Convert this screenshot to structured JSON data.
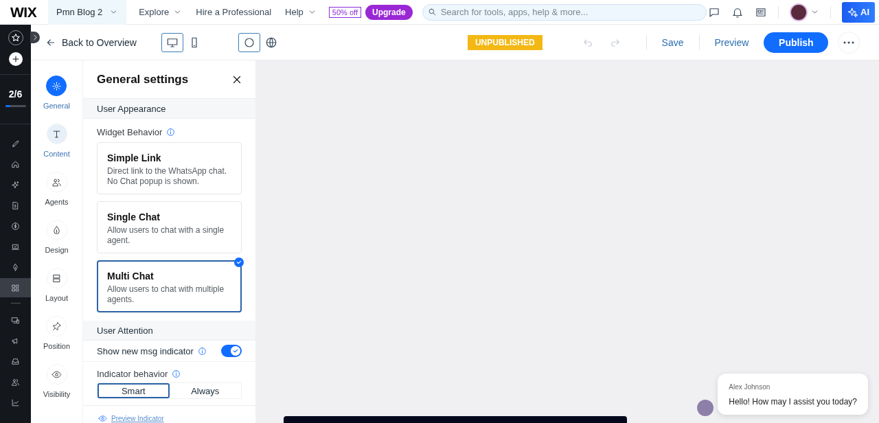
{
  "top_bar": {
    "logo": "WIX",
    "site": {
      "label": "Pmn Blog 2"
    },
    "menus": [
      {
        "label": "Explore",
        "dropdown": true
      },
      {
        "label": "Hire a Professional",
        "dropdown": false
      },
      {
        "label": "Help",
        "dropdown": true
      }
    ],
    "sale_badge": "50% off",
    "upgrade_button": "Upgrade",
    "search": {
      "placeholder": "Search for tools, apps, help & more..."
    },
    "ai_button": "AI"
  },
  "editor_bar": {
    "back_link": "Back to Overview",
    "devices": [
      {
        "selected": true
      },
      {
        "selected": false
      }
    ],
    "views": [
      {
        "selected": true
      },
      {
        "selected": false
      }
    ],
    "status": "UNPUBLISHED",
    "undo": {
      "disabled": true
    },
    "redo": {
      "disabled": true
    },
    "save": "Save",
    "preview": "Preview",
    "publish": "Publish"
  },
  "rail": {
    "progress": {
      "label": "2/6",
      "level": 0.25
    },
    "items": [
      {
        "selected": false
      },
      {
        "selected": false
      },
      {
        "selected": false
      },
      {
        "selected": false
      },
      {
        "selected": false
      },
      {
        "selected": false
      },
      {
        "selected": false
      },
      {
        "selected": true
      },
      {
        "selected": false
      },
      {
        "selected": false
      },
      {
        "selected": false
      },
      {
        "selected": false
      },
      {
        "selected": false
      }
    ]
  },
  "settings_nav": [
    {
      "label": "General",
      "selected": true,
      "hovered": false
    },
    {
      "label": "Content",
      "selected": false,
      "hovered": true
    },
    {
      "label": "Agents",
      "selected": false,
      "hovered": false
    },
    {
      "label": "Design",
      "selected": false,
      "hovered": false
    },
    {
      "label": "Layout",
      "selected": false,
      "hovered": false
    },
    {
      "label": "Position",
      "selected": false,
      "hovered": false
    },
    {
      "label": "Visibility",
      "selected": false,
      "hovered": false
    }
  ],
  "panel": {
    "title": "General settings",
    "appearance": {
      "heading": "User Appearance",
      "label": "Widget Behavior",
      "options": [
        {
          "title": "Simple Link",
          "description": "Direct link to the WhatsApp chat. No Chat popup is shown.",
          "selected": false
        },
        {
          "title": "Single Chat",
          "description": "Allow users to chat with a single agent.",
          "selected": false
        },
        {
          "title": "Multi Chat",
          "description": "Allow users to chat with multiple agents.",
          "selected": true
        }
      ]
    },
    "attention": {
      "heading": "User Attention",
      "toggle": {
        "label": "Show new msg indicator",
        "on": true
      },
      "indicator": {
        "label": "Indicator behavior",
        "choices": [
          {
            "label": "Smart",
            "selected": true
          },
          {
            "label": "Always",
            "selected": false
          }
        ]
      },
      "preview_link": "Preview Indicator"
    }
  },
  "chat_preview": {
    "name": "Alex Johnson",
    "message": "Hello! How may I assist you today?"
  }
}
